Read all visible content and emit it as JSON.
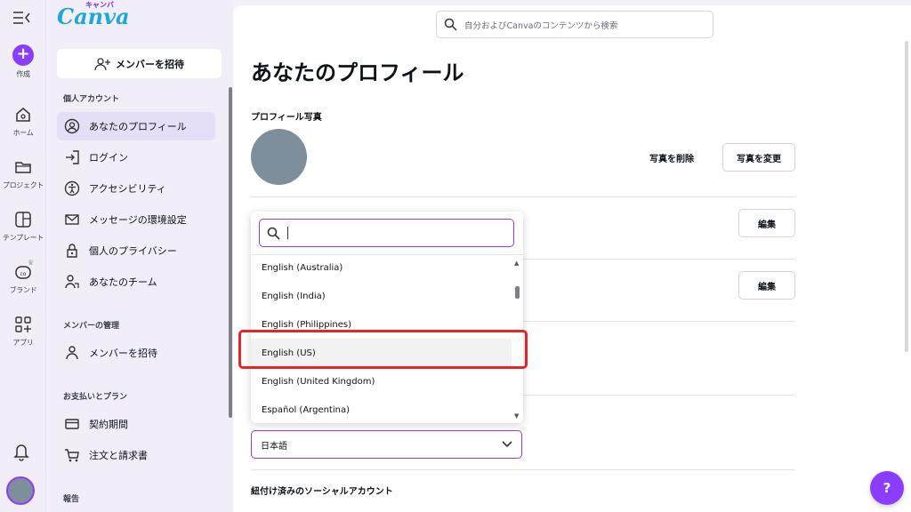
{
  "rail": {
    "create_label": "作成",
    "items": [
      {
        "label": "ホーム"
      },
      {
        "label": "プロジェクト"
      },
      {
        "label": "テンプレート"
      },
      {
        "label": "ブランド"
      },
      {
        "label": "アプリ"
      }
    ]
  },
  "sidebar": {
    "logo": "Canva",
    "logo_small": "キャンバ",
    "invite_button": "メンバーを招待",
    "sections": [
      {
        "title": "個人アカウント"
      },
      {
        "title": "メンバーの管理"
      },
      {
        "title": "お支払いとプラン"
      },
      {
        "title": "報告"
      }
    ],
    "items": [
      {
        "label": "あなたのプロフィール"
      },
      {
        "label": "ログイン"
      },
      {
        "label": "アクセシビリティ"
      },
      {
        "label": "メッセージの環境設定"
      },
      {
        "label": "個人のプライバシー"
      },
      {
        "label": "あなたのチーム"
      },
      {
        "label": "メンバーを招待"
      },
      {
        "label": "契約期間"
      },
      {
        "label": "注文と請求書"
      }
    ]
  },
  "main": {
    "search_placeholder": "自分およびCanvaのコンテンツから検索",
    "title": "あなたのプロフィール",
    "photo_label": "プロフィール写真",
    "remove_photo": "写真を削除",
    "change_photo": "写真を変更",
    "edit_label": "編集",
    "language_value": "日本語",
    "social_label": "紐付け済みのソーシャルアカウント"
  },
  "dropdown": {
    "search_value": "",
    "options": [
      {
        "label": "English (Australia)"
      },
      {
        "label": "English (India)"
      },
      {
        "label": "English (Philippines)"
      },
      {
        "label": "English (US)"
      },
      {
        "label": "English (United Kingdom)"
      },
      {
        "label": "Español (Argentina)"
      }
    ],
    "highlighted": "English (US)"
  },
  "help_label": "?",
  "colors": {
    "accent": "#8b3dff",
    "annotation": "#e3262c",
    "logo": "#1fa8d6"
  }
}
